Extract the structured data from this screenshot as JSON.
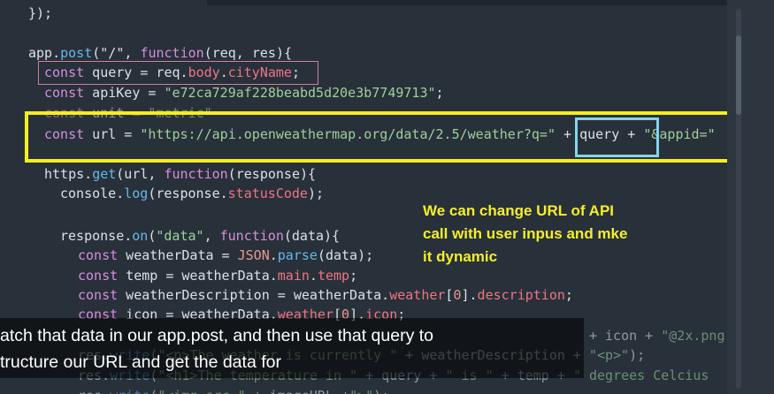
{
  "editor": {
    "lines": [
      {
        "id": "l1",
        "tokens": [
          [
            "pl",
            "});"
          ]
        ]
      },
      {
        "id": "l2",
        "tokens": [
          [
            "pl",
            "app."
          ],
          [
            "f",
            "post"
          ],
          [
            "pl",
            "(\"/\", "
          ],
          [
            "k",
            "function"
          ],
          [
            "pl",
            "(req, res){"
          ]
        ]
      },
      {
        "id": "l3",
        "tokens": [
          [
            "k",
            "const"
          ],
          [
            "pl",
            " query = req."
          ],
          [
            "p",
            "body"
          ],
          [
            "pl",
            "."
          ],
          [
            "p",
            "cityName"
          ],
          [
            "pl",
            ";"
          ]
        ]
      },
      {
        "id": "l4",
        "tokens": [
          [
            "k",
            "const"
          ],
          [
            "pl",
            " apiKey = "
          ],
          [
            "s",
            "\"e72ca729af228beabd5d20e3b7749713\""
          ],
          [
            "pl",
            ";"
          ]
        ]
      },
      {
        "id": "l5",
        "tokens": [
          [
            "k",
            "const"
          ],
          [
            "pl",
            " unit = "
          ],
          [
            "s",
            "\"metric\""
          ]
        ]
      },
      {
        "id": "l6",
        "tokens": [
          [
            "k",
            "const"
          ],
          [
            "pl",
            " url = "
          ],
          [
            "s",
            "\"https://api.openweathermap.org/data/2.5/weather?q=\""
          ],
          [
            "pl",
            " + query + "
          ],
          [
            "s",
            "\"&appid=\""
          ]
        ]
      },
      {
        "id": "l7",
        "tokens": [
          [
            "pl",
            "https."
          ],
          [
            "f",
            "get"
          ],
          [
            "pl",
            "(url, "
          ],
          [
            "k",
            "function"
          ],
          [
            "pl",
            "(response){"
          ]
        ]
      },
      {
        "id": "l8",
        "tokens": [
          [
            "pl",
            "console."
          ],
          [
            "f",
            "log"
          ],
          [
            "pl",
            "(response."
          ],
          [
            "p",
            "statusCode"
          ],
          [
            "pl",
            ");"
          ]
        ]
      },
      {
        "id": "l9",
        "tokens": [
          [
            "pl",
            "response."
          ],
          [
            "f",
            "on"
          ],
          [
            "pl",
            "("
          ],
          [
            "s",
            "\"data\""
          ],
          [
            "pl",
            ", "
          ],
          [
            "k",
            "function"
          ],
          [
            "pl",
            "(data){"
          ]
        ]
      },
      {
        "id": "l10",
        "tokens": [
          [
            "k",
            "const"
          ],
          [
            "pl",
            " weatherData = "
          ],
          [
            "r",
            "JSON"
          ],
          [
            "pl",
            "."
          ],
          [
            "f",
            "parse"
          ],
          [
            "pl",
            "(data);"
          ]
        ]
      },
      {
        "id": "l11",
        "tokens": [
          [
            "k",
            "const"
          ],
          [
            "pl",
            " temp = weatherData."
          ],
          [
            "p",
            "main"
          ],
          [
            "pl",
            "."
          ],
          [
            "p",
            "temp"
          ],
          [
            "pl",
            ";"
          ]
        ]
      },
      {
        "id": "l12",
        "tokens": [
          [
            "k",
            "const"
          ],
          [
            "pl",
            " weatherDescription = weatherData."
          ],
          [
            "p",
            "weather"
          ],
          [
            "pl",
            "["
          ],
          [
            "r",
            "0"
          ],
          [
            "pl",
            "]."
          ],
          [
            "p",
            "description"
          ],
          [
            "pl",
            ";"
          ]
        ]
      },
      {
        "id": "l13",
        "tokens": [
          [
            "k",
            "const"
          ],
          [
            "pl",
            " icon = weatherData."
          ],
          [
            "p",
            "weather"
          ],
          [
            "pl",
            "["
          ],
          [
            "r",
            "0"
          ],
          [
            "pl",
            "]."
          ],
          [
            "p",
            "icon"
          ],
          [
            "pl",
            ";"
          ]
        ]
      },
      {
        "id": "l14",
        "tokens": [
          [
            "pl",
            "                                                                + icon + "
          ],
          [
            "s",
            "\"@2x.png\""
          ],
          [
            "pl",
            ";"
          ]
        ]
      },
      {
        "id": "l15",
        "tokens": [
          [
            "pl",
            "res."
          ],
          [
            "f",
            "write"
          ],
          [
            "pl",
            "("
          ],
          [
            "s",
            "\"<p>The weather is currently \""
          ],
          [
            "pl",
            " + weatherDescription + "
          ],
          [
            "s",
            "\"<p>\""
          ],
          [
            "pl",
            ");"
          ]
        ]
      },
      {
        "id": "l16",
        "tokens": [
          [
            "pl",
            "res."
          ],
          [
            "f",
            "write"
          ],
          [
            "pl",
            "("
          ],
          [
            "s",
            "\"<h1>The temperature in \""
          ],
          [
            "pl",
            " + query + "
          ],
          [
            "s",
            "\" is \""
          ],
          [
            "pl",
            " + temp + "
          ],
          [
            "s",
            "\" degrees Celcius"
          ]
        ]
      },
      {
        "id": "l17",
        "tokens": [
          [
            "pl",
            "res."
          ],
          [
            "f",
            "write"
          ],
          [
            "pl",
            "("
          ],
          [
            "s",
            "\"<img src=\""
          ],
          [
            "pl",
            " + imageURL +"
          ],
          [
            "s",
            "\">\""
          ],
          [
            "pl",
            ");"
          ]
        ]
      }
    ]
  },
  "annotation": {
    "text_lines": [
      "We can change URL of API",
      "call with user inpus and mke",
      "it dynamic"
    ]
  },
  "subtitle": {
    "lines": [
      "atch that data in our app.post, and then use that query to",
      "tructure our URL and get the data for"
    ]
  },
  "colors": {
    "editor_bg": "#283039",
    "keyword": "#d68de0",
    "string": "#9fd09b",
    "property": "#f07484",
    "function": "#64b9ec",
    "highlight_yellow": "#f4ee22",
    "highlight_cyan": "#84d4ec",
    "highlight_pink": "#d07ea2"
  }
}
